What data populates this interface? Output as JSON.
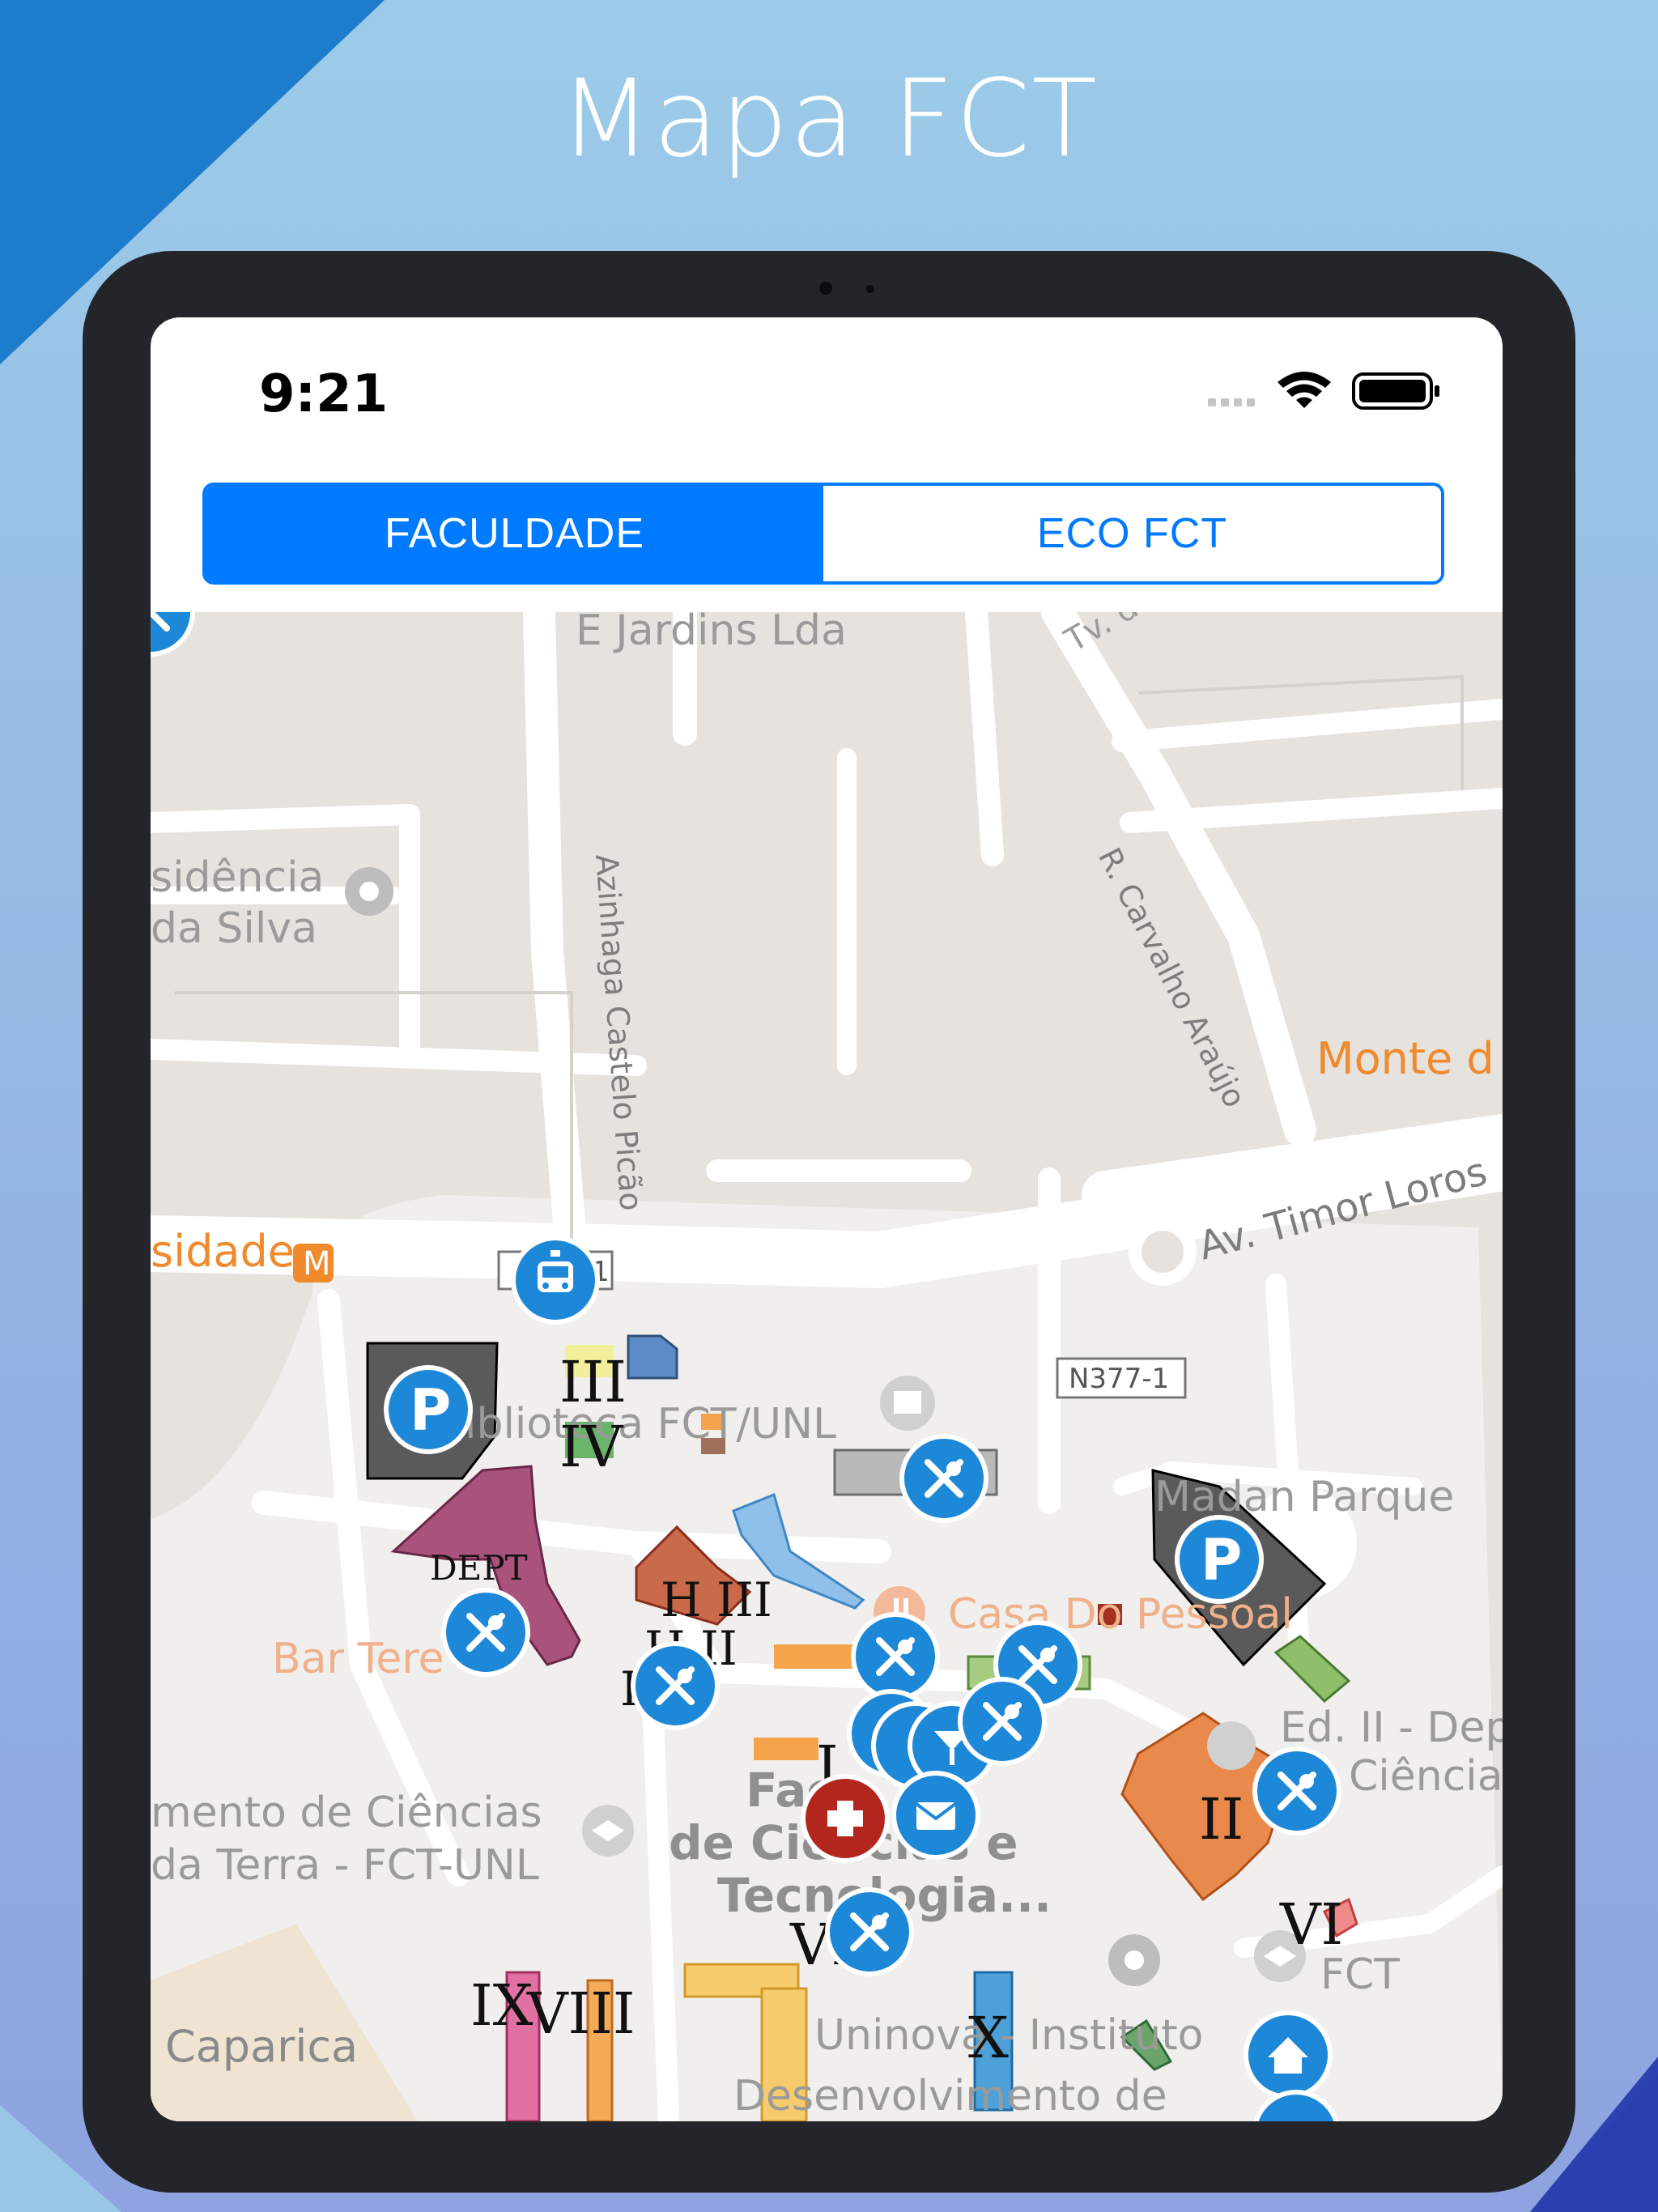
{
  "headline": "Mapa FCT",
  "status_bar": {
    "time": "9:21"
  },
  "segmented_control": {
    "options": [
      "FACULDADE",
      "ECO FCT"
    ],
    "selected": "FACULDADE"
  },
  "colors": {
    "accent": "#007aff",
    "pin_blue": "#1e88d8",
    "pin_red": "#b3261e",
    "parking_gray": "#5a5a5a"
  },
  "map": {
    "place_labels": [
      "E Jardins Lda",
      "Tv. d",
      "sidência",
      "da Silva",
      "Azinhaga Castelo Picão",
      "R. Carvalho Araújo",
      "Monte d",
      "Av. Timor Loros",
      "sidade",
      "M",
      "1",
      "N377-1",
      "iblioteca FCT/UNL",
      "Madan Parque",
      "Bar Tere",
      "Casa Do Pessoal",
      "Ed. II - Dep",
      "Ciência",
      "mento de Ciências",
      "da Terra - FCT-UNL",
      "Fac",
      "de Ciências e",
      "Tecnologia...",
      "Uninova - Instituto",
      "Desenvolvimento de",
      "FCT",
      "Caparica"
    ],
    "building_labels": [
      "III",
      "IV",
      "DEPT",
      "H III",
      "H II",
      "H I",
      "I",
      "VII",
      "X",
      "II",
      "VI",
      "IX",
      "VIII"
    ]
  }
}
